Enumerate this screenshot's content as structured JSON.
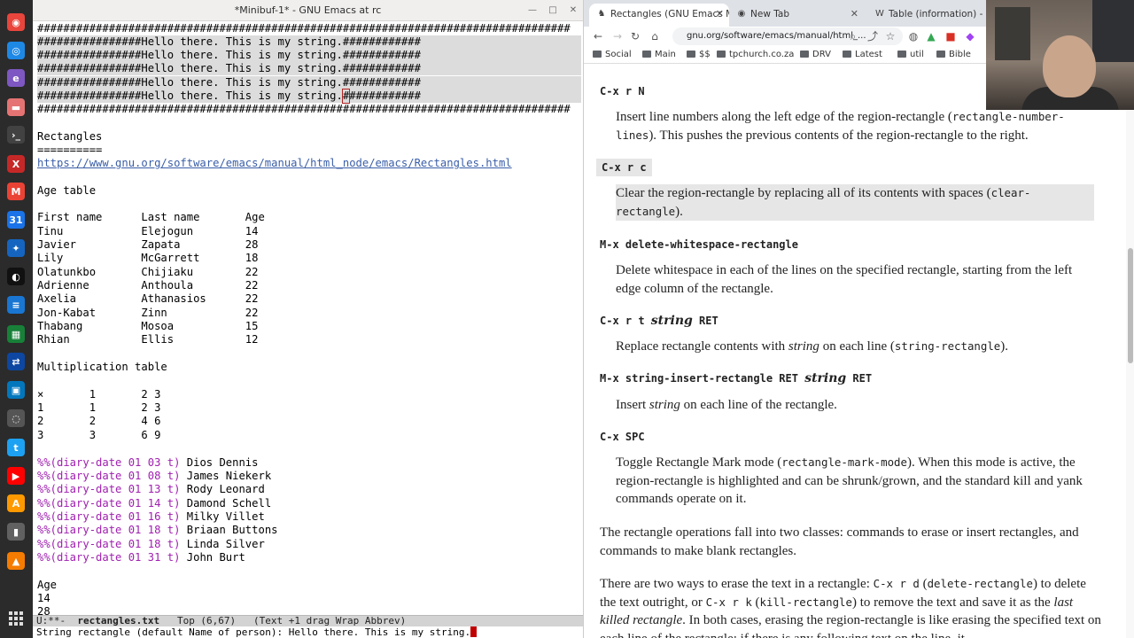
{
  "dock": {
    "icons": [
      {
        "name": "chrome-icon",
        "glyph": "◉",
        "color": "#e8453c"
      },
      {
        "name": "browser-icon",
        "glyph": "◎",
        "color": "#1e88e5"
      },
      {
        "name": "emacs-icon",
        "glyph": "e",
        "color": "#7e57c2"
      },
      {
        "name": "files-icon",
        "glyph": "▬",
        "color": "#e57373"
      },
      {
        "name": "terminal-icon",
        "glyph": "›_",
        "color": "#424242"
      },
      {
        "name": "x-app-icon",
        "glyph": "X",
        "color": "#c62828"
      },
      {
        "name": "gmail-icon",
        "glyph": "M",
        "color": "#ea4335"
      },
      {
        "name": "calendar-icon",
        "glyph": "31",
        "color": "#1a73e8"
      },
      {
        "name": "app-blue-icon",
        "glyph": "✦",
        "color": "#1565c0"
      },
      {
        "name": "github-icon",
        "glyph": "◐",
        "color": "#111111"
      },
      {
        "name": "docs-icon",
        "glyph": "≡",
        "color": "#1976d2"
      },
      {
        "name": "sheets-icon",
        "glyph": "▦",
        "color": "#188038"
      },
      {
        "name": "remote-icon",
        "glyph": "⇄",
        "color": "#0d47a1"
      },
      {
        "name": "meet-icon",
        "glyph": "▣",
        "color": "#0277bd"
      },
      {
        "name": "app-gray-icon",
        "glyph": "◌",
        "color": "#555555"
      },
      {
        "name": "twitter-icon",
        "glyph": "t",
        "color": "#1da1f2"
      },
      {
        "name": "youtube-icon",
        "glyph": "▶",
        "color": "#ff0000"
      },
      {
        "name": "amazon-icon",
        "glyph": "A",
        "color": "#ff9900"
      },
      {
        "name": "usb-icon",
        "glyph": "▮",
        "color": "#616161"
      },
      {
        "name": "vlc-icon",
        "glyph": "▲",
        "color": "#f57c00"
      }
    ]
  },
  "emacs": {
    "title": "*Minibuf-1* - GNU Emacs at rc",
    "lines": {
      "l0": "##################################################################################",
      "l1": "################Hello there. This is my string.############",
      "l2": "################Hello there. This is my string.############",
      "l3": "################Hello there. This is my string.############",
      "l4": "################Hello there. This is my string.############",
      "l5a": "################Hello there. This is my string.",
      "l5b": "#",
      "l5c": "###########",
      "l6": "##################################################################################",
      "rect_title": "Rectangles",
      "rect_underline": "==========",
      "url": "https://www.gnu.org/software/emacs/manual/html_node/emacs/Rectangles.html",
      "age_table": "Age table",
      "header": "First name      Last name       Age",
      "r1": "Tinu            Elejogun        14",
      "r2": "Javier          Zapata          28",
      "r3": "Lily            McGarrett       18",
      "r4": "Olatunkbo       Chijiaku        22",
      "r5": "Adrienne        Anthoula        22",
      "r6": "Axelia          Athanasios      22",
      "r7": "Jon-Kabat       Zinn            22",
      "r8": "Thabang         Mosoa           15",
      "r9": "Rhian           Ellis           12",
      "mult_title": "Multiplication table",
      "m0": "×       1       2 3",
      "m1": "1       1       2 3",
      "m2": "2       2       4 6",
      "m3": "3       3       6 9",
      "d1k": "%%(diary-date 01 03 t)",
      "d1v": " Dios Dennis",
      "d2k": "%%(diary-date 01 08 t)",
      "d2v": " James Niekerk",
      "d3k": "%%(diary-date 01 13 t)",
      "d3v": " Rody Leonard",
      "d4k": "%%(diary-date 01 14 t)",
      "d4v": " Damond Schell",
      "d5k": "%%(diary-date 01 16 t)",
      "d5v": " Milky Villet",
      "d6k": "%%(diary-date 01 18 t)",
      "d6v": " Briaan Buttons",
      "d7k": "%%(diary-date 01 18 t)",
      "d7v": " Linda Silver",
      "d8k": "%%(diary-date 01 31 t)",
      "d8v": " John Burt",
      "age": "Age",
      "age1": "14",
      "age2": "28"
    },
    "modeline": {
      "status": "U:**-  ",
      "buffer": "rectangles.txt",
      "rest": "   Top (6,67)   (Text +1 drag Wrap Abbrev)"
    },
    "minibuffer": "String rectangle (default Name of person): Hello there. This is my string."
  },
  "browser": {
    "tabs": [
      {
        "label": "Rectangles (GNU Emacs Manual)",
        "icon": "gnu-icon"
      },
      {
        "label": "New Tab",
        "icon": "chrome-icon"
      },
      {
        "label": "Table (information) - Wikipedia",
        "icon": "wikipedia-icon"
      }
    ],
    "url": "gnu.org/software/emacs/manual/html_...",
    "bookmarks": [
      "Social",
      "Main",
      "$$",
      "tpchurch.co.za",
      "DRV",
      "Latest",
      "util",
      "Bible"
    ],
    "doc": {
      "k1": "C-x r N",
      "p1a": "Insert line numbers along the left edge of the region-rectangle (",
      "p1code": "rectangle-number-lines",
      "p1b": "). This pushes the previous contents of the region-rectangle to the right.",
      "k2": "C-x r c",
      "p2a": "Clear the region-rectangle by replacing all of its contents with spaces (",
      "p2code": "clear-rectangle",
      "p2b": ").",
      "k3": "M-x delete-whitespace-rectangle",
      "p3": "Delete whitespace in each of the lines on the specified rectangle, starting from the left edge column of the rectangle.",
      "k4a": "C-x r t ",
      "k4i": "string",
      "k4b": " RET",
      "p4a": "Replace rectangle contents with ",
      "p4i": "string",
      "p4b": " on each line (",
      "p4code": "string-rectangle",
      "p4c": ").",
      "k5a": "M-x string-insert-rectangle RET ",
      "k5i": "string",
      "k5b": " RET",
      "p5a": "Insert ",
      "p5i": "string",
      "p5b": " on each line of the rectangle.",
      "k6": "C-x SPC",
      "p6a": "Toggle Rectangle Mark mode (",
      "p6code": "rectangle-mark-mode",
      "p6b": "). When this mode is active, the region-rectangle is highlighted and can be shrunk/grown, and the standard kill and yank commands operate on it.",
      "p7": "The rectangle operations fall into two classes: commands to erase or insert rectangles, and commands to make blank rectangles.",
      "p8a": "There are two ways to erase the text in a rectangle: ",
      "p8c1": "C-x r d",
      "p8b": " (",
      "p8c2": "delete-rectangle",
      "p8d": ") to delete the text outright, or ",
      "p8c3": "C-x r k",
      "p8e": " (",
      "p8c4": "kill-rectangle",
      "p8f": ") to remove the text and save it as the ",
      "p8i": "last killed rectangle",
      "p8g": ". In both cases, erasing the region-rectangle is like erasing the specified text on each line of the rectangle; if there is any following text on the line, it"
    }
  }
}
